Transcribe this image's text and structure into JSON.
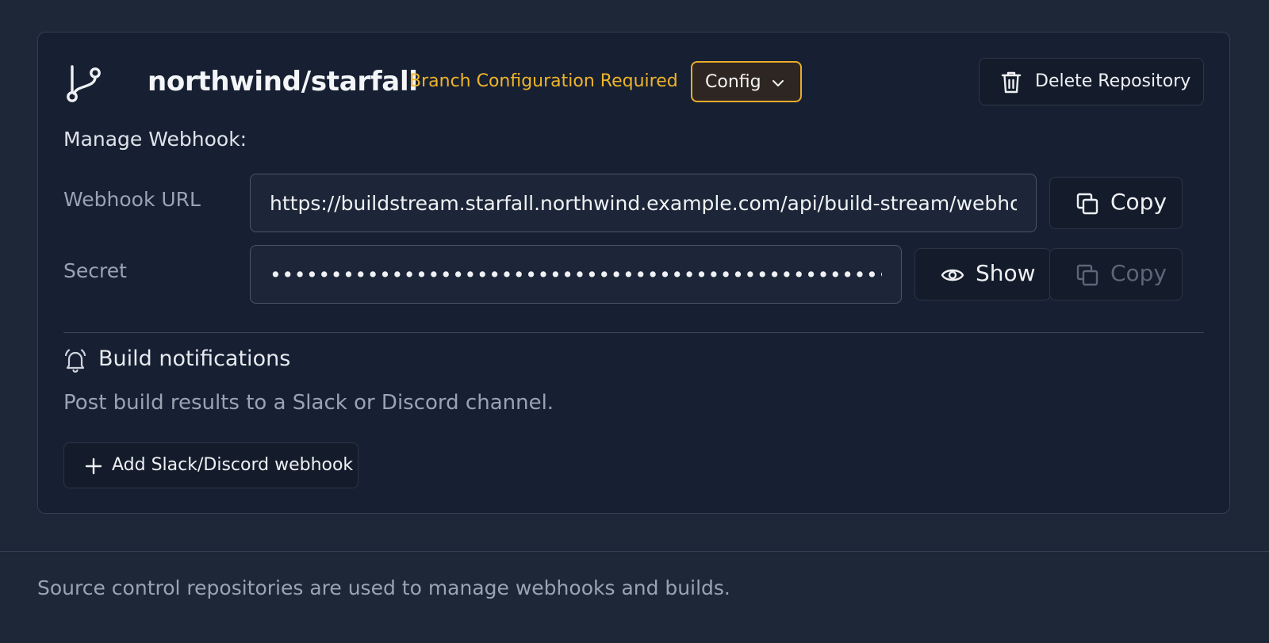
{
  "repository": {
    "name": "northwind/starfall",
    "status_text": "Branch Configuration Required",
    "config_label": "Config",
    "delete_label": "Delete Repository"
  },
  "webhook": {
    "section_label": "Manage Webhook:",
    "url_label": "Webhook URL",
    "url_value": "https://buildstream.starfall.northwind.example.com/api/build-stream/webhook",
    "copy_label": "Copy",
    "secret_label": "Secret",
    "secret_masked": "•••••••••••••••••••••••••••••••••••••••••••••••••••••••••••••",
    "show_label": "Show",
    "secret_copy_label": "Copy"
  },
  "notifications": {
    "title": "Build notifications",
    "description": "Post build results to a Slack or Discord channel.",
    "add_label": "Add Slack/Discord webhook"
  },
  "footer": {
    "text": "Source control repositories are used to manage webhooks and builds."
  },
  "colors": {
    "background": "#1e2738",
    "card": "#172032",
    "warning": "#f0b429",
    "config_border": "#e9ac2c"
  }
}
